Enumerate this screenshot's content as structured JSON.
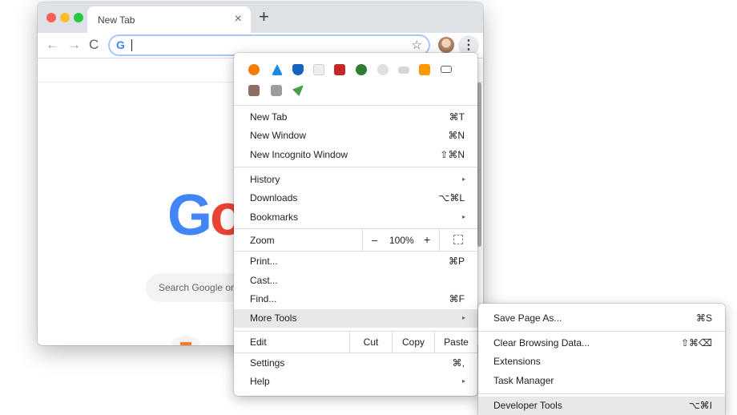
{
  "tab": {
    "title": "New Tab",
    "close": "×",
    "new_tab": "+"
  },
  "toolbar": {
    "back": "←",
    "forward": "→",
    "reload": "C",
    "omnibox_logo": "G",
    "star": "☆",
    "menu": "⋮"
  },
  "page": {
    "logo_g": "G",
    "logo_o": "o",
    "search_placeholder": "Search Google or"
  },
  "menu": {
    "extension_icons": [
      "avast-icon",
      "vector-icon",
      "shield-icon",
      "blank-extension-icon",
      "red-square-icon",
      "green-check-icon",
      "clip-icon",
      "gray-box-icon",
      "orange-chart-icon",
      "laptop-icon",
      "notebook-icon",
      "f-icon",
      "rocket-icon"
    ],
    "items": [
      {
        "label": "New Tab",
        "shortcut": "⌘T"
      },
      {
        "label": "New Window",
        "shortcut": "⌘N"
      },
      {
        "label": "New Incognito Window",
        "shortcut": "⇧⌘N"
      },
      {
        "label": "History",
        "shortcut": "▸"
      },
      {
        "label": "Downloads",
        "shortcut": "⌥⌘L"
      },
      {
        "label": "Bookmarks",
        "shortcut": "▸"
      }
    ],
    "zoom": {
      "label": "Zoom",
      "minus": "–",
      "value": "100%",
      "plus": "+"
    },
    "items2": [
      {
        "label": "Print...",
        "shortcut": "⌘P"
      },
      {
        "label": "Cast...",
        "shortcut": ""
      },
      {
        "label": "Find...",
        "shortcut": "⌘F"
      },
      {
        "label": "More Tools",
        "shortcut": "▸"
      }
    ],
    "edit": {
      "label": "Edit",
      "cut": "Cut",
      "copy": "Copy",
      "paste": "Paste"
    },
    "items3": [
      {
        "label": "Settings",
        "shortcut": "⌘,"
      },
      {
        "label": "Help",
        "shortcut": "▸"
      }
    ]
  },
  "submenu": {
    "items": [
      {
        "label": "Save Page As...",
        "shortcut": "⌘S"
      },
      {
        "label": "Clear Browsing Data...",
        "shortcut": "⇧⌘⌫"
      },
      {
        "label": "Extensions",
        "shortcut": ""
      },
      {
        "label": "Task Manager",
        "shortcut": ""
      },
      {
        "label": "Developer Tools",
        "shortcut": "⌥⌘I"
      }
    ]
  }
}
